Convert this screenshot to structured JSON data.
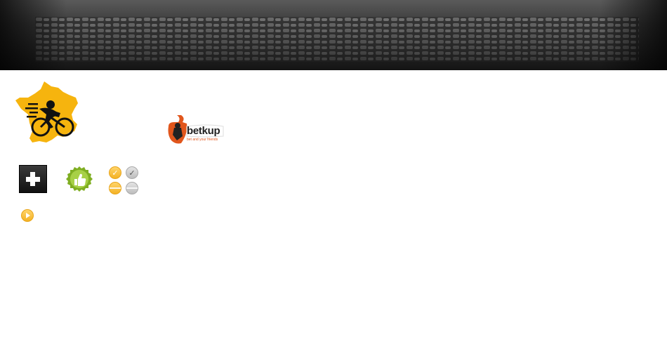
{
  "header": {
    "banner": "cobblestone-road-banner"
  },
  "logos": {
    "main": "france-cyclist-logo",
    "partner": {
      "brand": "betkup",
      "tagline": "bet and your friends"
    }
  },
  "toolbar": {
    "add_icon": "plus-icon",
    "like_icon": "thumbs-up-icon",
    "status_icons": {
      "check_yellow": "✓",
      "check_gray": "✓"
    },
    "play_icon": "play-icon"
  },
  "colors": {
    "accent_yellow": "#F4B225",
    "map_orange": "#F6B40E",
    "betkup_orange": "#E1561C",
    "badge_green": "#8DBE2D",
    "banner_dark": "#1A1A1A"
  }
}
